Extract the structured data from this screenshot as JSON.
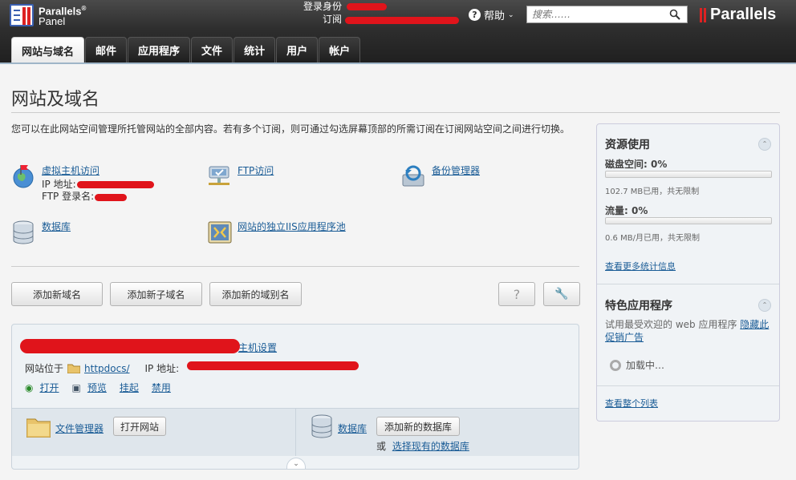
{
  "header": {
    "brand_line1": "Parallels",
    "brand_line2": "Panel",
    "login_label": "登录身份",
    "subscription_label": "订阅",
    "help_label": "帮助",
    "search_placeholder": "搜索……",
    "right_brand": "Parallels"
  },
  "tabs": [
    {
      "label": "网站与域名",
      "active": true
    },
    {
      "label": "邮件"
    },
    {
      "label": "应用程序"
    },
    {
      "label": "文件"
    },
    {
      "label": "统计"
    },
    {
      "label": "用户"
    },
    {
      "label": "帐户"
    }
  ],
  "page": {
    "title": "网站及域名",
    "intro": "您可以在此网站空间管理所托管网站的全部内容。若有多个订阅，则可通过勾选屏幕顶部的所需订阅在订阅网站空间之间进行切换。"
  },
  "tools": {
    "hosting_access": "虚拟主机访问",
    "ip_label": "IP 地址:",
    "ftp_login_label": "FTP 登录名:",
    "ftp_access": "FTP访问",
    "backup_manager": "备份管理器",
    "databases": "数据库",
    "iis_pool": "网站的独立IIS应用程序池"
  },
  "buttons": {
    "add_domain": "添加新域名",
    "add_subdomain": "添加新子域名",
    "add_alias": "添加新的域别名",
    "help": "?",
    "settings": "🔧"
  },
  "subscription": {
    "host_settings": "主机设置",
    "site_location_label": "网站位于",
    "site_folder": "httpdocs/",
    "ip_label": "IP 地址:",
    "open": "打开",
    "preview": "预览",
    "suspend": "挂起",
    "disable": "禁用",
    "file_manager": "文件管理器",
    "open_site": "打开网站",
    "databases": "数据库",
    "add_database": "添加新的数据库",
    "or": "或",
    "select_existing_db": "选择现有的数据库"
  },
  "sidebar": {
    "resources_title": "资源使用",
    "disk_label": "磁盘空间: 0%",
    "disk_detail": "102.7 MB已用，共无限制",
    "traffic_label": "流量: 0%",
    "traffic_detail": "0.6 MB/月已用，共无限制",
    "more_stats": "查看更多统计信息",
    "featured_title": "特色应用程序",
    "featured_desc": "试用最受欢迎的 web 应用程序",
    "hide_promo": "隐藏此促销广告",
    "loading": "加载中…",
    "view_list": "查看整个列表",
    "disk_percent": 0,
    "traffic_percent": 0
  },
  "colors": {
    "link": "#1a5c96",
    "redaction": "#e0141b",
    "brand_red": "#dd2222"
  }
}
